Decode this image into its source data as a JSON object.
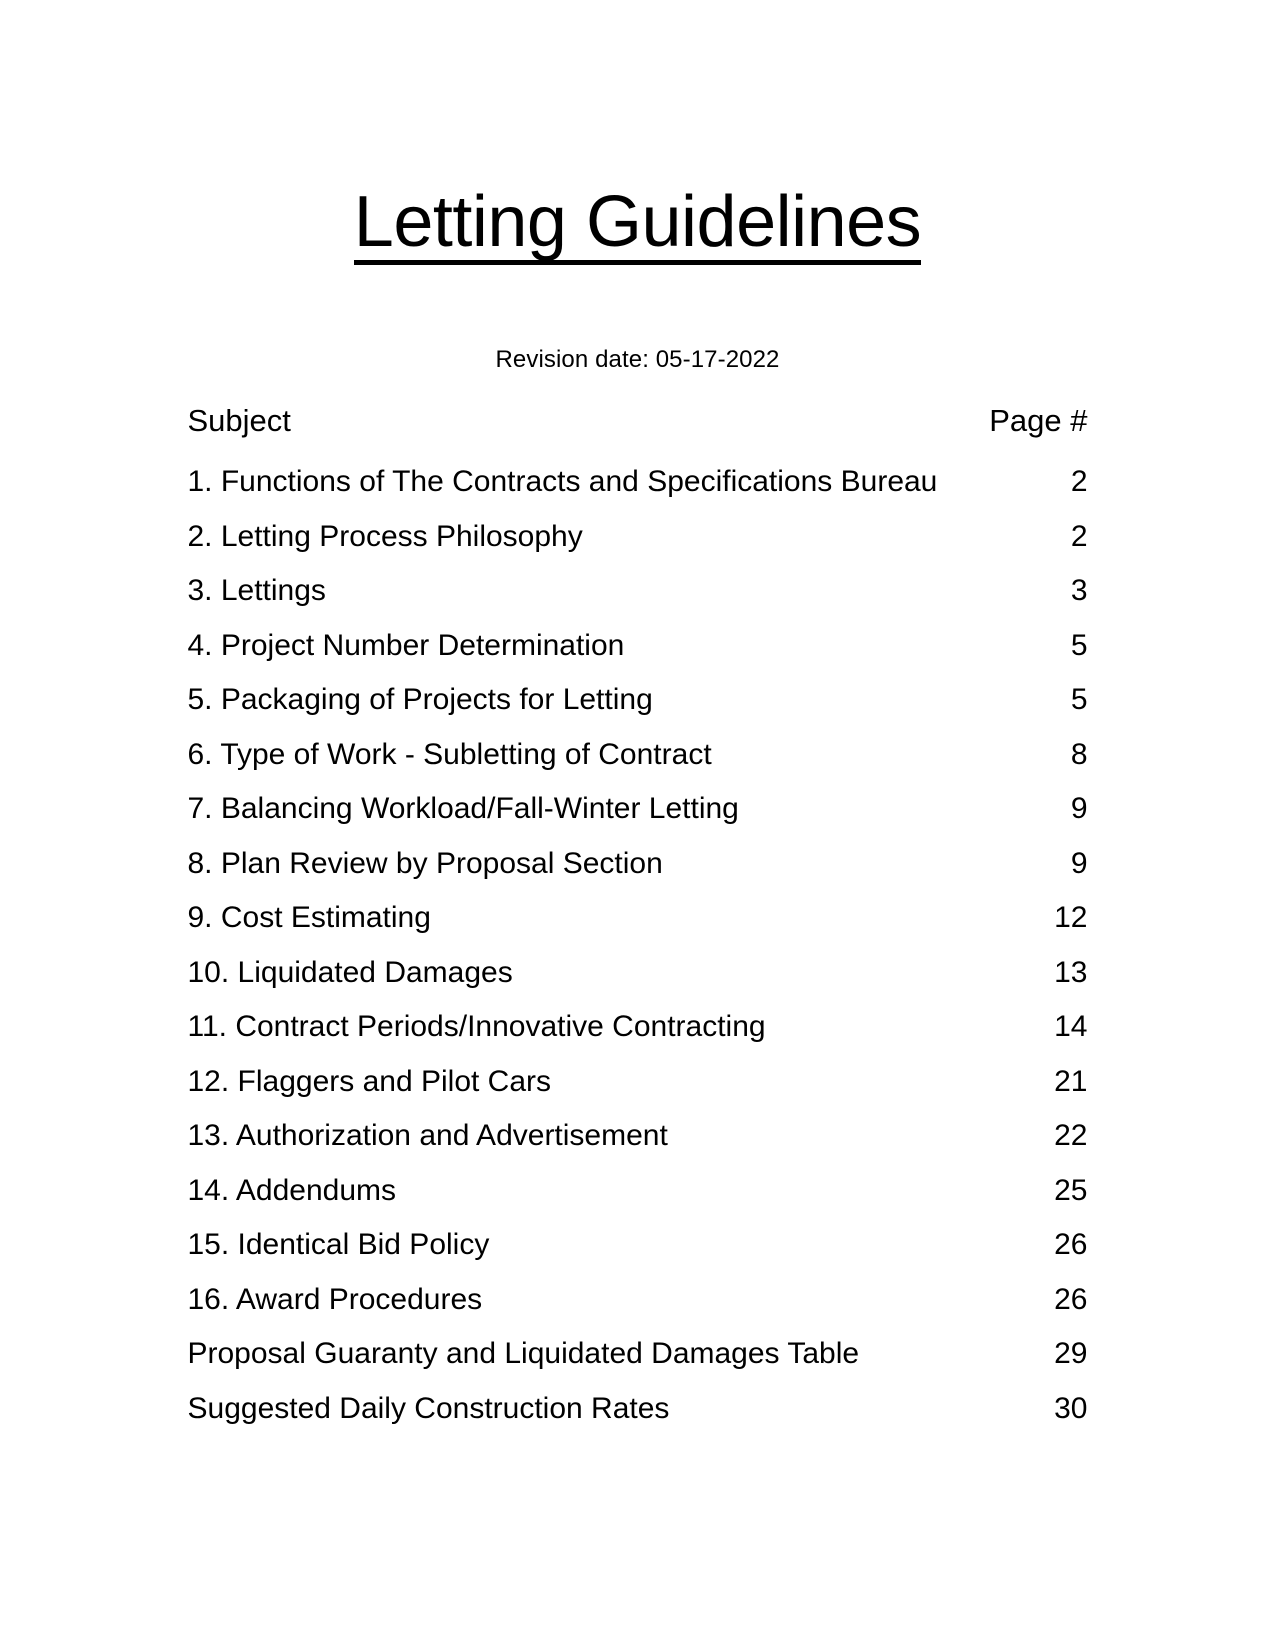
{
  "document": {
    "title": "Letting Guidelines",
    "revision_line": "Revision date: 05-17-2022",
    "columns": {
      "subject": "Subject",
      "page": "Page #"
    },
    "entries": [
      {
        "subject": "1. Functions of The Contracts and Specifications Bureau",
        "page": "2"
      },
      {
        "subject": "2. Letting Process Philosophy",
        "page": "2"
      },
      {
        "subject": "3. Lettings",
        "page": "3"
      },
      {
        "subject": "4. Project Number Determination",
        "page": "5"
      },
      {
        "subject": "5. Packaging of Projects for Letting",
        "page": "5"
      },
      {
        "subject": "6. Type of Work - Subletting of Contract",
        "page": "8"
      },
      {
        "subject": "7. Balancing Workload/Fall-Winter Letting",
        "page": "9"
      },
      {
        "subject": "8. Plan Review by Proposal Section",
        "page": "9"
      },
      {
        "subject": "9. Cost Estimating",
        "page": "12"
      },
      {
        "subject": "10. Liquidated Damages",
        "page": "13"
      },
      {
        "subject": "11. Contract Periods/Innovative Contracting",
        "page": "14"
      },
      {
        "subject": "12. Flaggers and Pilot Cars",
        "page": "21"
      },
      {
        "subject": "13. Authorization and Advertisement",
        "page": "22"
      },
      {
        "subject": "14. Addendums",
        "page": "25"
      },
      {
        "subject": "15. Identical Bid Policy",
        "page": "26"
      },
      {
        "subject": "16. Award Procedures",
        "page": "26"
      },
      {
        "subject": "Proposal Guaranty and Liquidated Damages Table",
        "page": "29"
      },
      {
        "subject": "Suggested Daily Construction Rates",
        "page": "30"
      }
    ]
  }
}
